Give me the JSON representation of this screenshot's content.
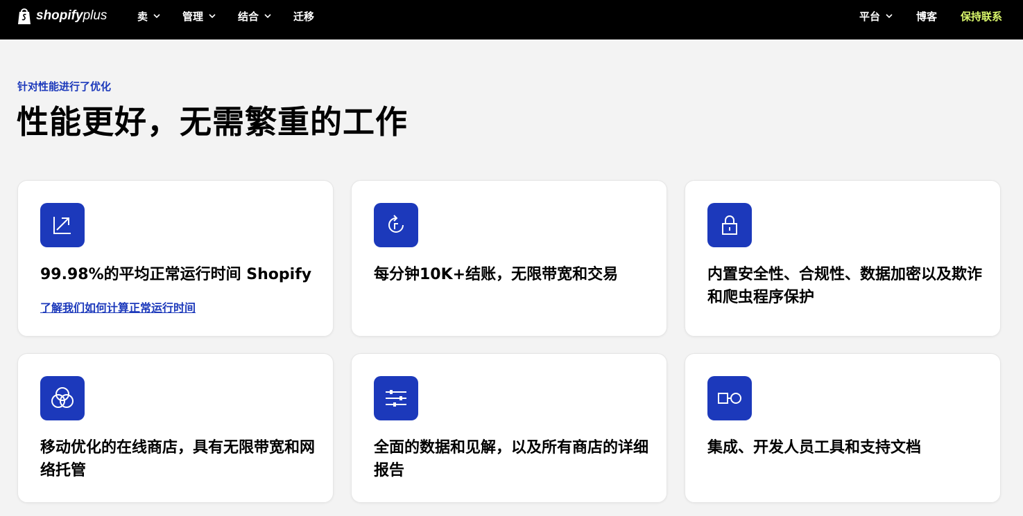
{
  "header": {
    "logo_alt": "shopify plus",
    "logo_brand": "shopify",
    "logo_suffix": "plus",
    "nav_left": [
      {
        "label": "卖"
      },
      {
        "label": "管理"
      },
      {
        "label": "结合"
      },
      {
        "label": "迁移"
      }
    ],
    "nav_right": [
      {
        "label": "平台"
      },
      {
        "label": "博客"
      },
      {
        "label": "保持联系"
      }
    ]
  },
  "section": {
    "eyebrow": "针对性能进行了优化",
    "title": "性能更好，无需繁重的工作"
  },
  "cards": [
    {
      "icon": "trend-up-arrow-icon",
      "title": "99.98%的平均正常运行时间 Shopify",
      "link": "了解我们如何计算正常运行时间"
    },
    {
      "icon": "refresh-icon",
      "title": "每分钟10K+结账，无限带宽和交易"
    },
    {
      "icon": "lock-icon",
      "title": "内置安全性、合规性、数据加密以及欺诈和爬虫程序保护"
    },
    {
      "icon": "overlapping-circles-icon",
      "title": "移动优化的在线商店，具有无限带宽和网络托管"
    },
    {
      "icon": "sliders-icon",
      "title": "全面的数据和见解，以及所有商店的详细报告"
    },
    {
      "icon": "integration-icon",
      "title": "集成、开发人员工具和支持文档"
    }
  ],
  "colors": {
    "accent": "#1c39bb",
    "contact": "#d9f66b",
    "header_bg": "#000000",
    "page_bg": "#f3f3f3"
  }
}
